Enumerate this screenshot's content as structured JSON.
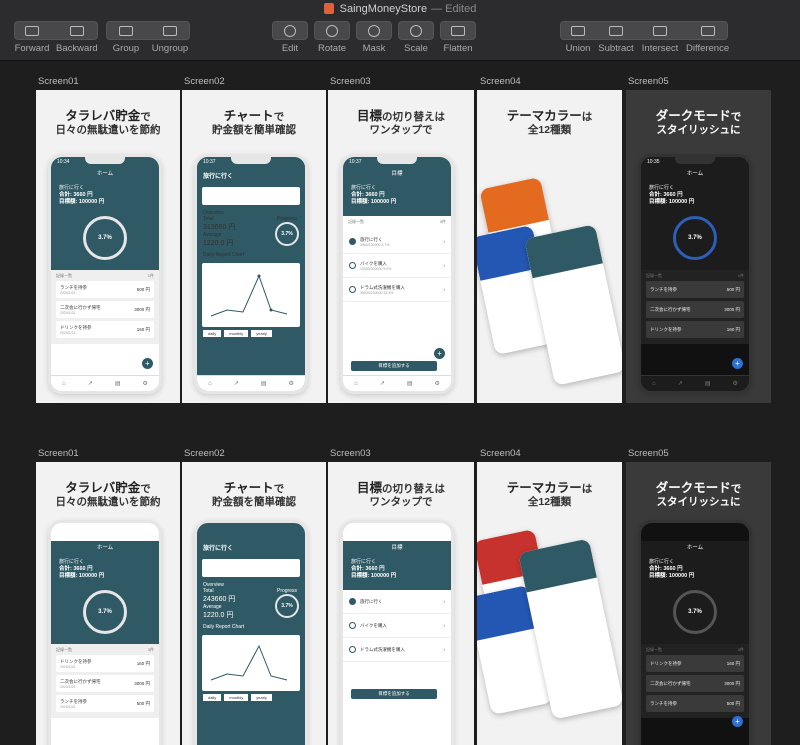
{
  "window": {
    "title": "SaingMoneyStore",
    "status": "— Edited"
  },
  "toolbar": {
    "forward": "Forward",
    "backward": "Backward",
    "group": "Group",
    "ungroup": "Ungroup",
    "edit": "Edit",
    "rotate": "Rotate",
    "mask": "Mask",
    "scale": "Scale",
    "flatten": "Flatten",
    "union": "Union",
    "subtract": "Subtract",
    "intersect": "Intersect",
    "difference": "Difference"
  },
  "artboards": {
    "s1": {
      "label": "Screen01",
      "h1": "タラレバ貯金",
      "h1b": "で",
      "h2": "日々の無駄遣いを節約"
    },
    "s2": {
      "label": "Screen02",
      "h1": "チャート",
      "h1b": "で",
      "h2": "貯金額を簡単確認"
    },
    "s3": {
      "label": "Screen03",
      "h1": "目標",
      "h1b": "の切り替えは",
      "h2": "ワンタップで"
    },
    "s4": {
      "label": "Screen04",
      "h1": "テーマカラー",
      "h1b": "は",
      "h2": "全12種類"
    },
    "s5": {
      "label": "Screen05",
      "h1": "ダークモード",
      "h1b": "で",
      "h2": "スタイリッシュに"
    }
  },
  "app": {
    "home": "ホーム",
    "goal": "旅行に行く",
    "total": "合計: 3660 円",
    "target": "目標額: 100000 円",
    "percent": "3.7%",
    "list_header": "記録一覧",
    "items_row1": [
      {
        "name": "ランチを持参",
        "date": "2020/1/21",
        "amount": "500 円"
      },
      {
        "name": "二次会に行かず帰宅",
        "date": "2020/1/21",
        "amount": "3000 円"
      },
      {
        "name": "ドリンクを持参",
        "date": "2020/1/21",
        "amount": "160 円"
      }
    ],
    "items_row2": [
      {
        "name": "ドリンクを持参",
        "date": "2020/1/21",
        "amount": "160 円"
      },
      {
        "name": "二次会に行かず帰宅",
        "date": "2020/1/21",
        "amount": "3000 円"
      },
      {
        "name": "ランチを持参",
        "date": "2020/1/21",
        "amount": "500 円"
      }
    ],
    "chart_title": "旅行に行く",
    "overview": "Overview",
    "total_label": "Total",
    "total_val_1": "313660 円",
    "total_val_2": "243660 円",
    "average_label": "Average",
    "average_val": "1220.0 円",
    "progress_label": "Progress",
    "daily_chart": "Daily Report Chart",
    "btn_daily": "daily",
    "btn_monthly": "monthly",
    "btn_yearly": "yearly",
    "goals_title": "目標",
    "goals": [
      {
        "name": "旅行に行く",
        "sub": "3660/100000 3.7%"
      },
      {
        "name": "バイクを購入",
        "sub": "10000/200000 5.0%"
      },
      {
        "name": "ドラム式洗濯機を購入",
        "sub": "35000/150000 23.3%"
      }
    ],
    "add_goal": "目標を追加する"
  }
}
